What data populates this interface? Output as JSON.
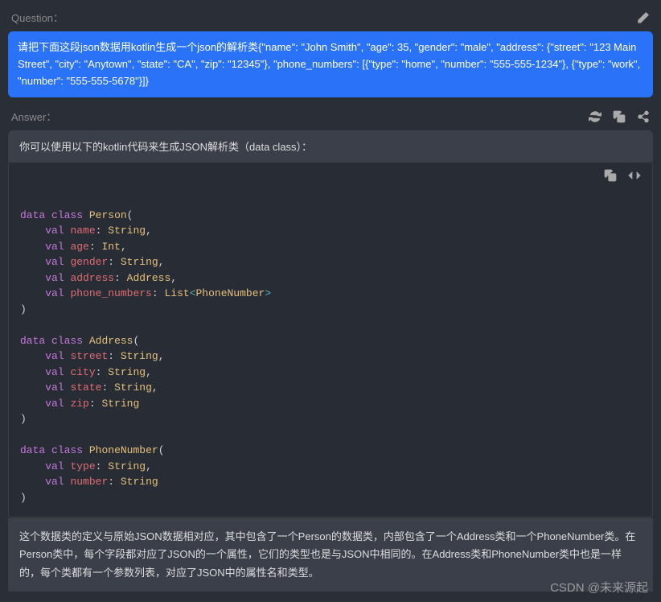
{
  "question": {
    "label": "Question：",
    "text": "请把下面这段json数据用kotlin生成一个json的解析类{\"name\": \"John Smith\", \"age\": 35, \"gender\": \"male\", \"address\": {\"street\": \"123 Main Street\", \"city\": \"Anytown\", \"state\": \"CA\", \"zip\": \"12345\"}, \"phone_numbers\": [{\"type\": \"home\", \"number\": \"555-555-1234\"}, {\"type\": \"work\", \"number\": \"555-555-5678\"}]}"
  },
  "answer": {
    "label": "Answer：",
    "intro": "你可以使用以下的kotlin代码来生成JSON解析类（data class）：",
    "footer": "这个数据类的定义与原始JSON数据相对应，其中包含了一个Person的数据类，内部包含了一个Address类和一个PhoneNumber类。在Person类中，每个字段都对应了JSON的一个属性，它们的类型也是与JSON中相同的。在Address类和PhoneNumber类中也是一样的，每个类都有一个参数列表，对应了JSON中的属性名和类型。"
  },
  "code": {
    "person": {
      "name": "Person",
      "fields": [
        {
          "k": "val",
          "n": "name",
          "t": "String",
          "c": ","
        },
        {
          "k": "val",
          "n": "age",
          "t": "Int",
          "c": ","
        },
        {
          "k": "val",
          "n": "gender",
          "t": "String",
          "c": ","
        },
        {
          "k": "val",
          "n": "address",
          "t": "Address",
          "c": ","
        },
        {
          "k": "val",
          "n": "phone_numbers",
          "t": "List",
          "g": "PhoneNumber",
          "c": ""
        }
      ]
    },
    "address": {
      "name": "Address",
      "fields": [
        {
          "k": "val",
          "n": "street",
          "t": "String",
          "c": ","
        },
        {
          "k": "val",
          "n": "city",
          "t": "String",
          "c": ","
        },
        {
          "k": "val",
          "n": "state",
          "t": "String",
          "c": ","
        },
        {
          "k": "val",
          "n": "zip",
          "t": "String",
          "c": ""
        }
      ]
    },
    "phone": {
      "name": "PhoneNumber",
      "fields": [
        {
          "k": "val",
          "n": "type",
          "t": "String",
          "c": ","
        },
        {
          "k": "val",
          "n": "number",
          "t": "String",
          "c": ""
        }
      ]
    }
  },
  "watermark": "CSDN @未来源起"
}
